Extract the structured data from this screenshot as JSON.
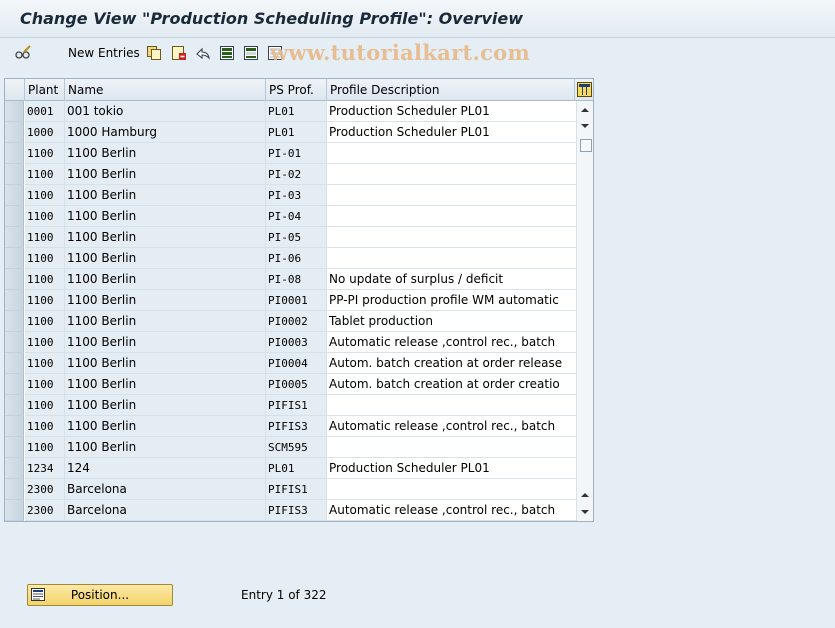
{
  "title": "Change View \"Production Scheduling Profile\": Overview",
  "toolbar": {
    "new_entries_label": "New Entries",
    "icons": [
      "glasses-pencil-icon",
      "copy-icon",
      "delete-icon",
      "undo-icon",
      "select-all-icon",
      "select-block-icon",
      "deselect-all-icon"
    ]
  },
  "watermark": "www.tutorialkart.com",
  "table": {
    "headers": [
      "Plant",
      "Name",
      "PS Prof.",
      "Profile Description"
    ],
    "rows": [
      {
        "plant": "0001",
        "name": "001 tokio",
        "prof": "PL01",
        "desc": "Production Scheduler PL01"
      },
      {
        "plant": "1000",
        "name": "1000 Hamburg",
        "prof": "PL01",
        "desc": "Production Scheduler PL01"
      },
      {
        "plant": "1100",
        "name": "1100 Berlin",
        "prof": "PI-01",
        "desc": ""
      },
      {
        "plant": "1100",
        "name": "1100 Berlin",
        "prof": "PI-02",
        "desc": ""
      },
      {
        "plant": "1100",
        "name": "1100 Berlin",
        "prof": "PI-03",
        "desc": ""
      },
      {
        "plant": "1100",
        "name": "1100 Berlin",
        "prof": "PI-04",
        "desc": ""
      },
      {
        "plant": "1100",
        "name": "1100 Berlin",
        "prof": "PI-05",
        "desc": ""
      },
      {
        "plant": "1100",
        "name": "1100 Berlin",
        "prof": "PI-06",
        "desc": ""
      },
      {
        "plant": "1100",
        "name": "1100 Berlin",
        "prof": "PI-08",
        "desc": "No update of surplus / deficit"
      },
      {
        "plant": "1100",
        "name": "1100 Berlin",
        "prof": "PI0001",
        "desc": "PP-PI production profile WM automatic"
      },
      {
        "plant": "1100",
        "name": "1100 Berlin",
        "prof": "PI0002",
        "desc": "Tablet production"
      },
      {
        "plant": "1100",
        "name": "1100 Berlin",
        "prof": "PI0003",
        "desc": "Automatic release ,control rec., batch"
      },
      {
        "plant": "1100",
        "name": "1100 Berlin",
        "prof": "PI0004",
        "desc": "Autom. batch creation at order release"
      },
      {
        "plant": "1100",
        "name": "1100 Berlin",
        "prof": "PI0005",
        "desc": "Autom. batch creation at order creatio"
      },
      {
        "plant": "1100",
        "name": "1100 Berlin",
        "prof": "PIFIS1",
        "desc": ""
      },
      {
        "plant": "1100",
        "name": "1100 Berlin",
        "prof": "PIFIS3",
        "desc": "Automatic release ,control rec., batch"
      },
      {
        "plant": "1100",
        "name": "1100 Berlin",
        "prof": "SCM595",
        "desc": ""
      },
      {
        "plant": "1234",
        "name": "124",
        "prof": "PL01",
        "desc": "Production Scheduler PL01"
      },
      {
        "plant": "2300",
        "name": "Barcelona",
        "prof": "PIFIS1",
        "desc": ""
      },
      {
        "plant": "2300",
        "name": "Barcelona",
        "prof": "PIFIS3",
        "desc": "Automatic release ,control rec., batch"
      }
    ]
  },
  "footer": {
    "position_label": "Position...",
    "entry_info": "Entry 1 of 322"
  }
}
